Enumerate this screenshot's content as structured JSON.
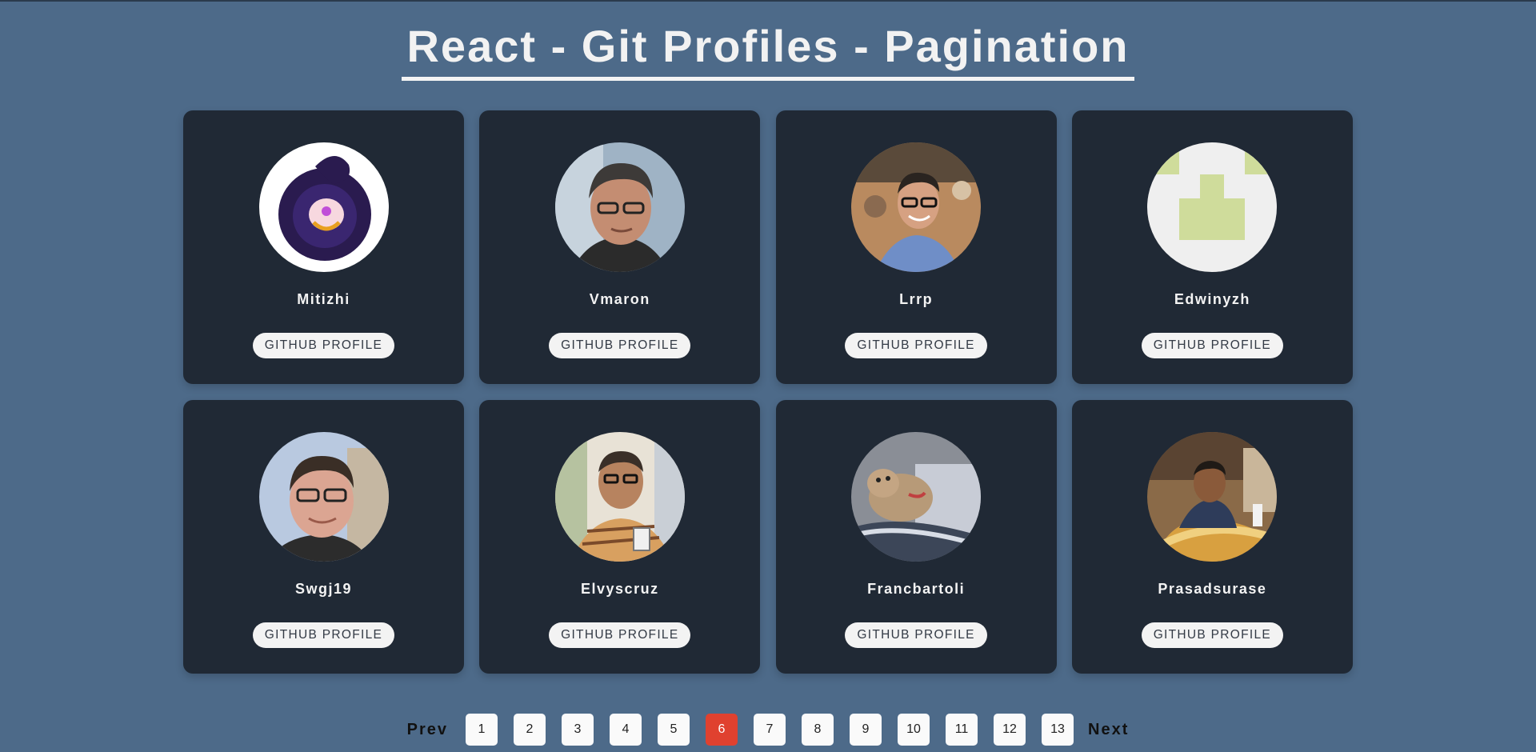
{
  "page": {
    "title": "React - Git Profiles - Pagination"
  },
  "profiles": [
    {
      "name": "Mitizhi",
      "button_label": "GITHUB PROFILE",
      "avatar": "swirl-creature-avatar"
    },
    {
      "name": "Vmaron",
      "button_label": "GITHUB PROFILE",
      "avatar": "man-portrait-avatar"
    },
    {
      "name": "Lrrp",
      "button_label": "GITHUB PROFILE",
      "avatar": "smiling-man-avatar"
    },
    {
      "name": "Edwinyzh",
      "button_label": "GITHUB PROFILE",
      "avatar": "identicon-avatar"
    },
    {
      "name": "Swgj19",
      "button_label": "GITHUB PROFILE",
      "avatar": "man-selfie-avatar"
    },
    {
      "name": "Elvyscruz",
      "button_label": "GITHUB PROFILE",
      "avatar": "sketch-man-avatar"
    },
    {
      "name": "Francbartoli",
      "button_label": "GITHUB PROFILE",
      "avatar": "dog-avatar"
    },
    {
      "name": "Prasadsurase",
      "button_label": "GITHUB PROFILE",
      "avatar": "man-dining-avatar"
    }
  ],
  "pagination": {
    "prev_label": "Prev",
    "next_label": "Next",
    "pages": [
      "1",
      "2",
      "3",
      "4",
      "5",
      "6",
      "7",
      "8",
      "9",
      "10",
      "11",
      "12",
      "13"
    ],
    "active_page": "6",
    "active_color": "#e0412f"
  },
  "colors": {
    "background": "#4d6a89",
    "card": "#202935"
  }
}
